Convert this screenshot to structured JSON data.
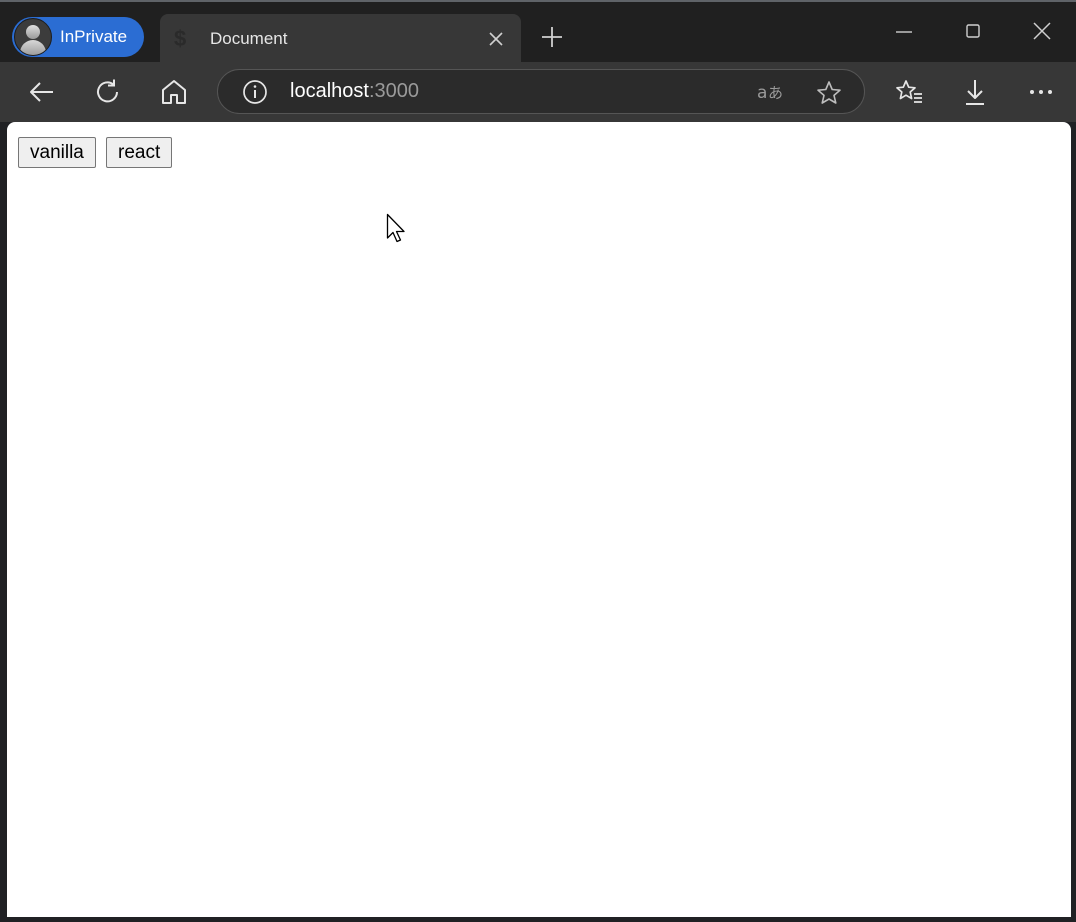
{
  "window": {
    "profile_label": "InPrivate",
    "tab_title": "Document",
    "tab_favicon": "$"
  },
  "address_bar": {
    "host": "localhost",
    "port": ":3000"
  },
  "icons": {
    "profile": "profile-avatar-icon",
    "tab_close": "close-icon",
    "new_tab": "plus-icon",
    "minimize": "minimize-icon",
    "maximize": "maximize-icon",
    "close_window": "close-icon",
    "back": "back-arrow-icon",
    "refresh": "refresh-icon",
    "home": "home-icon",
    "site_info": "info-icon",
    "read_aloud": "translate-icon",
    "favorite": "star-icon",
    "favorites": "favorites-icon",
    "downloads": "download-icon",
    "more": "more-icon"
  },
  "page": {
    "buttons": [
      "vanilla",
      "react"
    ]
  },
  "colors": {
    "profile_accent": "#2b6dd3",
    "chrome_dark": "#202020",
    "toolbar": "#373737"
  }
}
